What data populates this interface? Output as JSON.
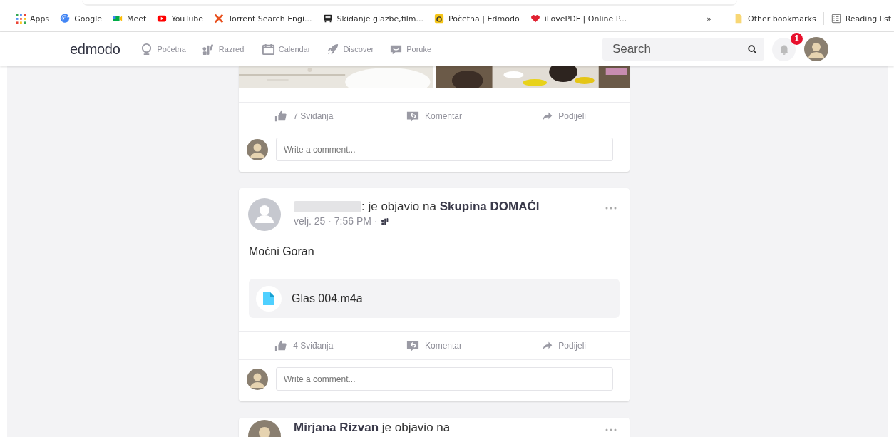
{
  "bookmarks": [
    {
      "label": "Apps",
      "kind": "apps"
    },
    {
      "label": "Google",
      "kind": "google"
    },
    {
      "label": "Meet",
      "kind": "meet"
    },
    {
      "label": "YouTube",
      "kind": "youtube"
    },
    {
      "label": "Torrent Search Engi...",
      "kind": "torrent"
    },
    {
      "label": "Skidanje glazbe,film...",
      "kind": "printer"
    },
    {
      "label": "Početna | Edmodo",
      "kind": "edmodo"
    },
    {
      "label": "iLovePDF | Online P...",
      "kind": "heart"
    }
  ],
  "bookmarks_more": "»",
  "other_bookmarks": "Other bookmarks",
  "reading_list": "Reading list",
  "nav": {
    "logo": "edmodo",
    "items": [
      {
        "label": "Početna",
        "kind": "home"
      },
      {
        "label": "Razredi",
        "kind": "classes"
      },
      {
        "label": "Calendar",
        "kind": "calendar"
      },
      {
        "label": "Discover",
        "kind": "rocket"
      },
      {
        "label": "Poruke",
        "kind": "messages"
      }
    ],
    "search": {
      "placeholder": "Search"
    },
    "notification_badge": "1"
  },
  "posts": [
    {
      "kind": "partial",
      "likes": "7 Sviđanja",
      "comment": "Komentar",
      "share": "Podijeli",
      "comment_placeholder": "Write a comment..."
    },
    {
      "kind": "full",
      "heading": ": je objavio na **Skupina DOMAĆI**",
      "time": "velj. 25 · 7:56 PM ·",
      "body": "Moćni Goran",
      "attachment": "Glas 004.m4a",
      "likes": "4 Sviđanja",
      "comment": "Komentar",
      "share": "Podijeli",
      "comment_placeholder": "Write a comment..."
    },
    {
      "kind": "header",
      "heading": "**Mirjana Rizvan** je objavio na"
    }
  ]
}
